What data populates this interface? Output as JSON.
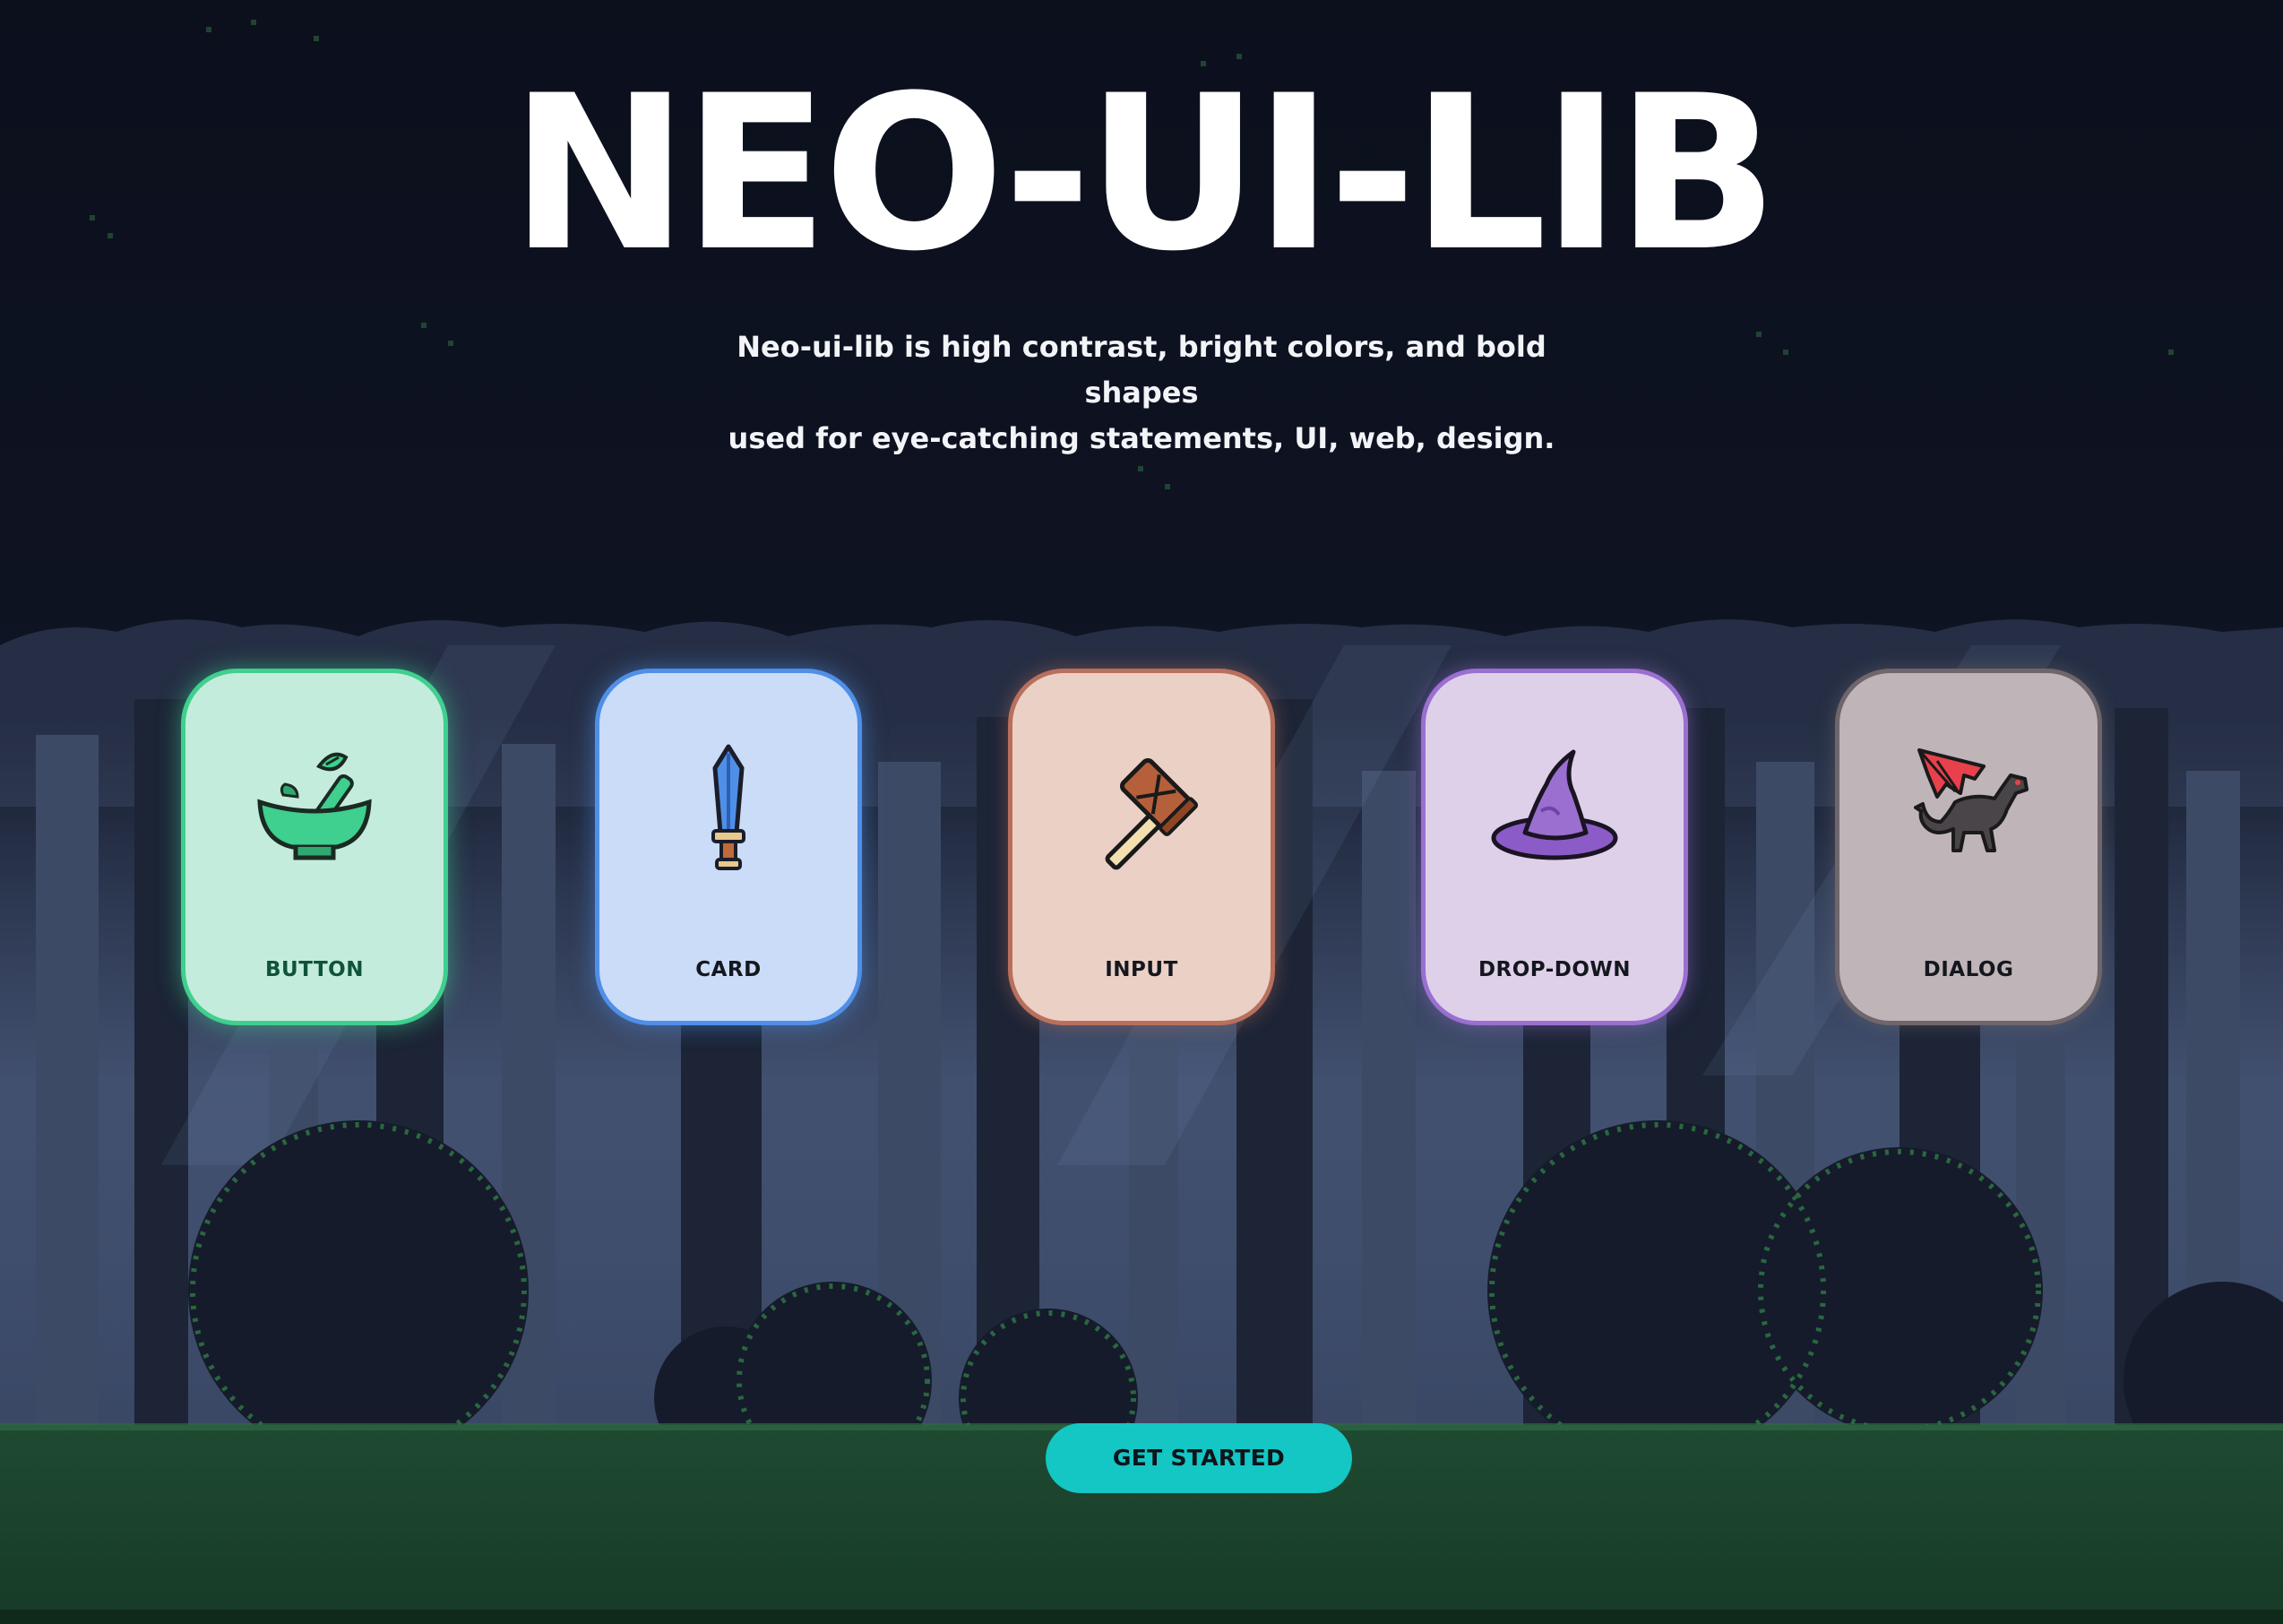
{
  "hero": {
    "title": "NEO-UI-LIB",
    "subtitle_line1": "Neo-ui-lib is high contrast, bright colors, and bold shapes",
    "subtitle_line2": "used for eye-catching statements, UI, web, design."
  },
  "cards": [
    {
      "label": "BUTTON",
      "icon": "mortar-pestle-icon"
    },
    {
      "label": "CARD",
      "icon": "sword-icon"
    },
    {
      "label": "INPUT",
      "icon": "hammer-icon"
    },
    {
      "label": "DROP-DOWN",
      "icon": "wizard-hat-icon"
    },
    {
      "label": "DIALOG",
      "icon": "dragon-icon"
    }
  ],
  "cta": {
    "label": "GET STARTED"
  },
  "colors": {
    "background": "#0d111f",
    "button_card": "#3fcf8e",
    "card_card": "#4f8fe8",
    "input_card": "#b8705d",
    "dropdown_card": "#9a6fd0",
    "dialog_card": "#6f666b",
    "cta": "#14c6c4"
  }
}
